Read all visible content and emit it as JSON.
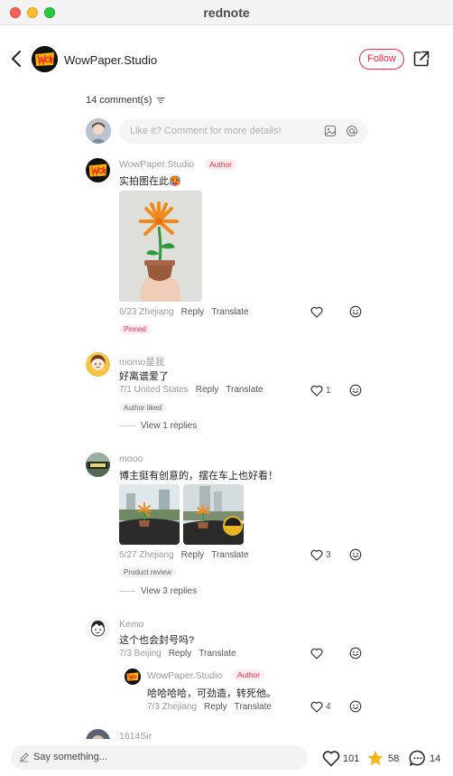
{
  "window": {
    "title": "rednote"
  },
  "header": {
    "author": "WowPaper.Studio",
    "follow": "Follow"
  },
  "comments_header": {
    "count_label": "14 comment(s)"
  },
  "comment_input": {
    "placeholder": "Like it? Comment for more details!"
  },
  "comments": [
    {
      "user": "WowPaper.Studio",
      "badge": "Author",
      "text": "实拍图在此🥵",
      "date": "6/23 Zhejiang",
      "reply": "Reply",
      "translate": "Translate",
      "tag": "Pinned",
      "likes": ""
    },
    {
      "user": "momo是我",
      "text": "好离谱爱了",
      "date": "7/1 United States",
      "reply": "Reply",
      "translate": "Translate",
      "tag": "Author liked",
      "likes": "1",
      "view_replies": "View 1 replies"
    },
    {
      "user": "mooo",
      "text": "博主挺有创意的，摆在车上也好看！",
      "date": "6/27 Zhejiang",
      "reply": "Reply",
      "translate": "Translate",
      "tag": "Product review",
      "likes": "3",
      "view_replies": "View 3 replies"
    },
    {
      "user": "Kemo",
      "text": "这个也会封号吗?",
      "date": "7/3 Beijing",
      "reply": "Reply",
      "translate": "Translate",
      "likes": ""
    },
    {
      "user": "1614Sir"
    }
  ],
  "reply": {
    "user": "WowPaper.Studio",
    "badge": "Author",
    "text": "哈哈哈哈，可劲造，转死他。",
    "date": "7/3 Zhejiang",
    "reply": "Reply",
    "translate": "Translate",
    "likes": "4"
  },
  "bottom": {
    "say_placeholder": "Say something...",
    "likes": "101",
    "stars": "58",
    "comments": "14"
  },
  "logo_text": "WOW",
  "colors": {
    "accent": "#ff2442",
    "star": "#f5b81b"
  }
}
